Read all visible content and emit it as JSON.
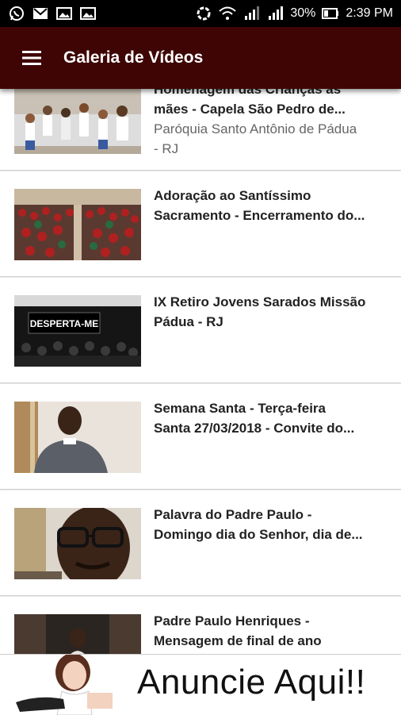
{
  "status_bar": {
    "battery": "30%",
    "time": "2:39 PM",
    "left_icons": [
      "whatsapp-icon",
      "gmail-icon",
      "image-icon",
      "image-icon"
    ],
    "right_icons": [
      "sync-icon",
      "wifi-icon",
      "signal-icon",
      "signal-icon",
      "battery-icon"
    ]
  },
  "app_bar": {
    "title": "Galeria de Vídeos",
    "color": "#3f0505",
    "menu_icon": "hamburger-menu-icon"
  },
  "videos": [
    {
      "title": "Homenagem das Crianças às\nmães - Capela São Pedro de...",
      "subtitle": "Paróquia Santo Antônio de Pádua\n- RJ"
    },
    {
      "title": "Adoração ao Santíssimo\nSacramento - Encerramento do...",
      "subtitle": ""
    },
    {
      "title": "IX Retiro Jovens Sarados Missão\nPádua - RJ",
      "subtitle": "",
      "thumb_text": "DESPERTA-ME"
    },
    {
      "title": "Semana Santa - Terça-feira\nSanta 27/03/2018 - Convite do...",
      "subtitle": ""
    },
    {
      "title": "Palavra do Padre Paulo -\nDomingo dia do Senhor, dia de...",
      "subtitle": ""
    },
    {
      "title": "Padre Paulo Henriques -\nMensagem de final de ano",
      "subtitle": ""
    }
  ],
  "ad_banner": {
    "text": "Anuncie Aqui!!"
  }
}
